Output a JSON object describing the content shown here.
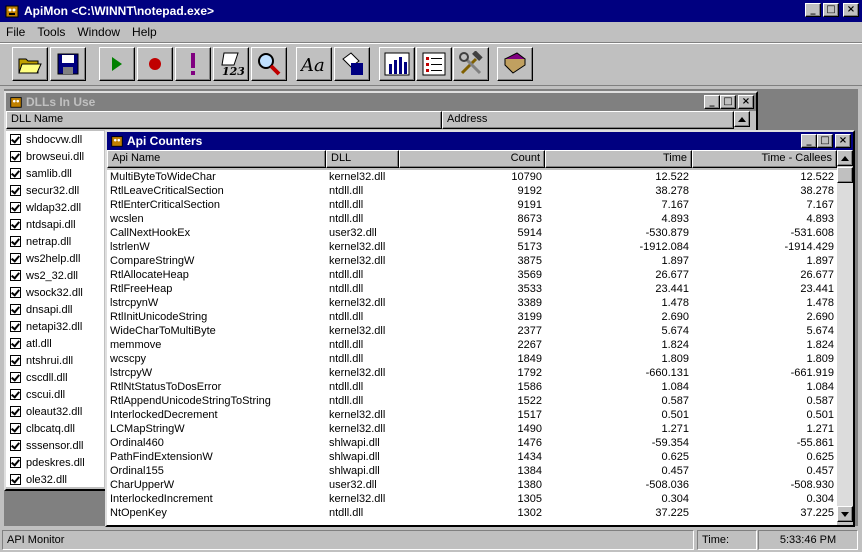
{
  "app": {
    "title": "ApiMon <C:\\WINNT\\notepad.exe>"
  },
  "menu": [
    "File",
    "Tools",
    "Window",
    "Help"
  ],
  "toolbar": [
    {
      "name": "open-icon"
    },
    {
      "name": "save-icon"
    },
    {
      "name": "run-icon"
    },
    {
      "name": "record-icon"
    },
    {
      "name": "alert-icon"
    },
    {
      "name": "counter-icon"
    },
    {
      "name": "find-icon"
    },
    {
      "name": "font-icon"
    },
    {
      "name": "paint-icon"
    },
    {
      "name": "graph-icon"
    },
    {
      "name": "list-icon"
    },
    {
      "name": "tools-icon"
    },
    {
      "name": "book-icon"
    }
  ],
  "dlls": {
    "title": "DLLs In Use",
    "col_name": "DLL Name",
    "col_address": "Address",
    "items": [
      "shdocvw.dll",
      "browseui.dll",
      "samlib.dll",
      "secur32.dll",
      "wldap32.dll",
      "ntdsapi.dll",
      "netrap.dll",
      "ws2help.dll",
      "ws2_32.dll",
      "wsock32.dll",
      "dnsapi.dll",
      "netapi32.dll",
      "atl.dll",
      "ntshrui.dll",
      "cscdll.dll",
      "cscui.dll",
      "oleaut32.dll",
      "clbcatq.dll",
      "sssensor.dll",
      "pdeskres.dll",
      "ole32.dll"
    ]
  },
  "api": {
    "title": "Api Counters",
    "headers": [
      "Api Name",
      "DLL",
      "Count",
      "Time",
      "Time - Callees"
    ],
    "rows": [
      [
        "MultiByteToWideChar",
        "kernel32.dll",
        "10790",
        "12.522",
        "12.522"
      ],
      [
        "RtlLeaveCriticalSection",
        "ntdll.dll",
        "9192",
        "38.278",
        "38.278"
      ],
      [
        "RtlEnterCriticalSection",
        "ntdll.dll",
        "9191",
        "7.167",
        "7.167"
      ],
      [
        "wcslen",
        "ntdll.dll",
        "8673",
        "4.893",
        "4.893"
      ],
      [
        "CallNextHookEx",
        "user32.dll",
        "5914",
        "-530.879",
        "-531.608"
      ],
      [
        "lstrlenW",
        "kernel32.dll",
        "5173",
        "-1912.084",
        "-1914.429"
      ],
      [
        "CompareStringW",
        "kernel32.dll",
        "3875",
        "1.897",
        "1.897"
      ],
      [
        "RtlAllocateHeap",
        "ntdll.dll",
        "3569",
        "26.677",
        "26.677"
      ],
      [
        "RtlFreeHeap",
        "ntdll.dll",
        "3533",
        "23.441",
        "23.441"
      ],
      [
        "lstrcpynW",
        "kernel32.dll",
        "3389",
        "1.478",
        "1.478"
      ],
      [
        "RtlInitUnicodeString",
        "ntdll.dll",
        "3199",
        "2.690",
        "2.690"
      ],
      [
        "WideCharToMultiByte",
        "kernel32.dll",
        "2377",
        "5.674",
        "5.674"
      ],
      [
        "memmove",
        "ntdll.dll",
        "2267",
        "1.824",
        "1.824"
      ],
      [
        "wcscpy",
        "ntdll.dll",
        "1849",
        "1.809",
        "1.809"
      ],
      [
        "lstrcpyW",
        "kernel32.dll",
        "1792",
        "-660.131",
        "-661.919"
      ],
      [
        "RtlNtStatusToDosError",
        "ntdll.dll",
        "1586",
        "1.084",
        "1.084"
      ],
      [
        "RtlAppendUnicodeStringToString",
        "ntdll.dll",
        "1522",
        "0.587",
        "0.587"
      ],
      [
        "InterlockedDecrement",
        "kernel32.dll",
        "1517",
        "0.501",
        "0.501"
      ],
      [
        "LCMapStringW",
        "kernel32.dll",
        "1490",
        "1.271",
        "1.271"
      ],
      [
        "Ordinal460",
        "shlwapi.dll",
        "1476",
        "-59.354",
        "-55.861"
      ],
      [
        "PathFindExtensionW",
        "shlwapi.dll",
        "1434",
        "0.625",
        "0.625"
      ],
      [
        "Ordinal155",
        "shlwapi.dll",
        "1384",
        "0.457",
        "0.457"
      ],
      [
        "CharUpperW",
        "user32.dll",
        "1380",
        "-508.036",
        "-508.930"
      ],
      [
        "InterlockedIncrement",
        "kernel32.dll",
        "1305",
        "0.304",
        "0.304"
      ],
      [
        "NtOpenKey",
        "ntdll.dll",
        "1302",
        "37.225",
        "37.225"
      ]
    ]
  },
  "status": {
    "text": "API Monitor",
    "time_label": "Time:",
    "time_value": "5:33:46 PM"
  }
}
